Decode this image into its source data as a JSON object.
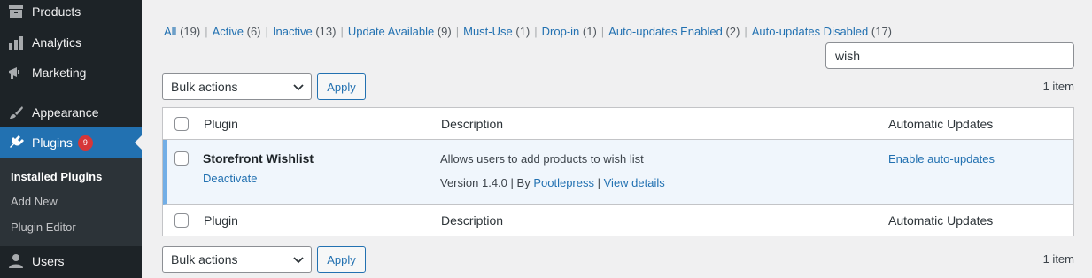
{
  "sidebar": {
    "items": [
      {
        "label": "Products",
        "icon": "archive-icon"
      },
      {
        "label": "Analytics",
        "icon": "bar-chart-icon"
      },
      {
        "label": "Marketing",
        "icon": "megaphone-icon"
      },
      {
        "label": "Appearance",
        "icon": "paintbrush-icon"
      },
      {
        "label": "Plugins",
        "icon": "plugin-icon",
        "badge": "9"
      },
      {
        "label": "Users",
        "icon": "user-icon"
      }
    ],
    "submenu": [
      "Installed Plugins",
      "Add New",
      "Plugin Editor"
    ]
  },
  "filters": [
    {
      "label": "All",
      "count": "(19)"
    },
    {
      "label": "Active",
      "count": "(6)"
    },
    {
      "label": "Inactive",
      "count": "(13)"
    },
    {
      "label": "Update Available",
      "count": "(9)"
    },
    {
      "label": "Must-Use",
      "count": "(1)"
    },
    {
      "label": "Drop-in",
      "count": "(1)"
    },
    {
      "label": "Auto-updates Enabled",
      "count": "(2)"
    },
    {
      "label": "Auto-updates Disabled",
      "count": "(17)"
    }
  ],
  "search": {
    "value": "wish"
  },
  "bulk": {
    "label": "Bulk actions",
    "apply": "Apply",
    "items_count": "1 item"
  },
  "table": {
    "columns": {
      "plugin": "Plugin",
      "description": "Description",
      "updates": "Automatic Updates"
    },
    "plugin": {
      "name": "Storefront Wishlist",
      "action": "Deactivate",
      "description": "Allows users to add products to wish list",
      "version": "Version 1.4.0",
      "by": "By",
      "author": "Pootlepress",
      "details": "View details",
      "auto_update": "Enable auto-updates"
    }
  },
  "colors": {
    "accent": "#2271b1",
    "sidebar": "#1d2327",
    "badge": "#d63638"
  }
}
